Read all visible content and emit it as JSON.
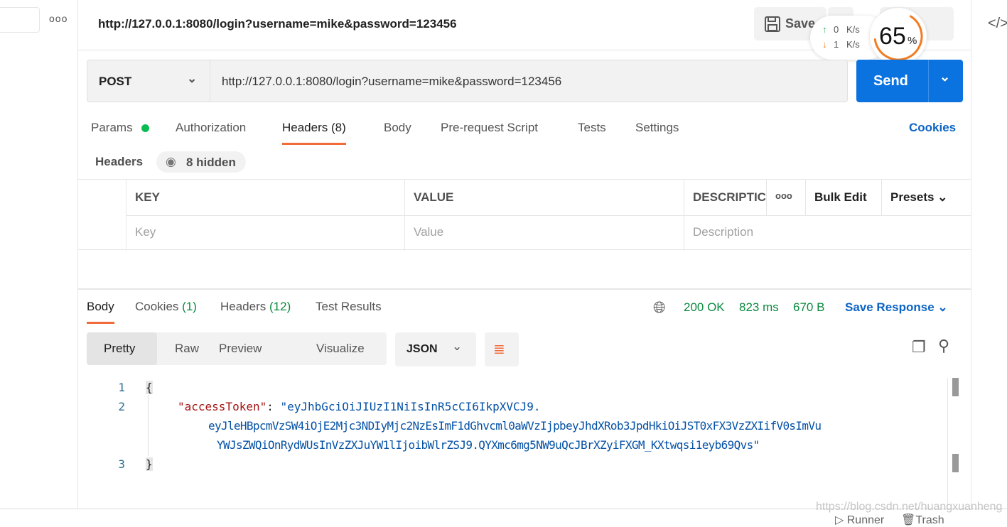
{
  "sidebar": {
    "more": "ooo"
  },
  "header": {
    "title": "http://127.0.0.1:8080/login?username=mike&password=123456",
    "save_label": "Save",
    "code_icon": "</>"
  },
  "netmon": {
    "up": "0",
    "down": "1",
    "unit": "K/s",
    "percent": "65",
    "percent_sign": "%",
    "progress": 65,
    "accent": "#f37b21"
  },
  "request": {
    "method": "POST",
    "url": "http://127.0.0.1:8080/login?username=mike&password=123456",
    "send_label": "Send"
  },
  "tabs": [
    {
      "label": "Params"
    },
    {
      "label": "Authorization"
    },
    {
      "label": "Headers (8)"
    },
    {
      "label": "Body"
    },
    {
      "label": "Pre-request Script"
    },
    {
      "label": "Tests"
    },
    {
      "label": "Settings"
    }
  ],
  "cookies_label": "Cookies",
  "headers_section": {
    "label": "Headers",
    "hidden": "8 hidden"
  },
  "table": {
    "columns": [
      "KEY",
      "VALUE",
      "DESCRIPTIC"
    ],
    "more": "ooo",
    "bulk_edit": "Bulk Edit",
    "presets": "Presets",
    "placeholders": [
      "Key",
      "Value",
      "Description"
    ]
  },
  "response": {
    "tabs": [
      {
        "label": "Body"
      },
      {
        "label": "Cookies",
        "count": "(1)"
      },
      {
        "label": "Headers",
        "count": "(12)"
      },
      {
        "label": "Test Results"
      }
    ],
    "status": "200 OK",
    "time": "823 ms",
    "size": "670 B",
    "save_label": "Save Response",
    "views": [
      "Pretty",
      "Raw",
      "Preview",
      "Visualize"
    ],
    "format": "JSON"
  },
  "code": {
    "lines": [
      "1",
      "2",
      "3"
    ],
    "open": "{",
    "key": "\"accessToken\"",
    "colon": ": ",
    "v1": "\"eyJhbGciOiJIUzI1NiIsInR5cCI6IkpXVCJ9.",
    "v2": "eyJleHBpcmVzSW4iOjE2Mjc3NDIyMjc2NzEsImF1dGhvcml0aWVzIjpbeyJhdXRob3JpdHkiOiJST0xFX3VzZXIifV0sImVu",
    "v3": "YWJsZWQiOnRydWUsInVzZXJuYW1lIjoibWlrZSJ9.QYXmc6mg5NW9uQcJBrXZyiFXGM_KXtwqsi1eyb69Qvs\"",
    "close": "}"
  },
  "footer": {
    "watermark": "https://blog.csdn.net/huangxuanheng",
    "runner": "Runner",
    "trash": "Trash"
  }
}
